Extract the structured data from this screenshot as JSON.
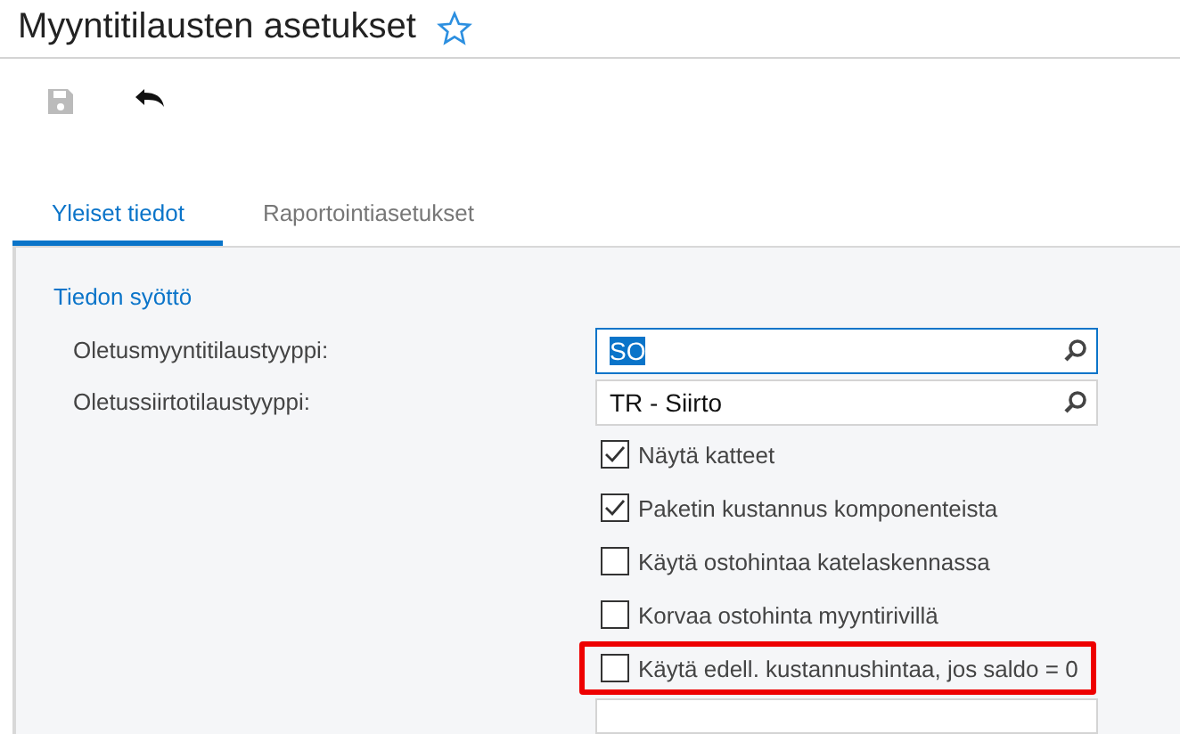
{
  "page": {
    "title": "Myyntitilausten asetukset",
    "favorite": false
  },
  "toolbar": [
    {
      "kind": "save",
      "disabled": true
    },
    {
      "kind": "undo",
      "disabled": false
    }
  ],
  "tabs": [
    {
      "label": "Yleiset tiedot",
      "selected": true
    },
    {
      "label": "Raportointiasetukset",
      "selected": false
    }
  ],
  "section": {
    "title": "Tiedon syöttö"
  },
  "fields": [
    {
      "label": "Oletusmyyntitilaustyyppi:",
      "value": "SO",
      "focused": true
    },
    {
      "label": "Oletussiirtotilaustyyppi:",
      "value": "TR - Siirto",
      "focused": false
    }
  ],
  "checkboxes": [
    {
      "label": "Näytä katteet",
      "checked": true,
      "highlighted": false
    },
    {
      "label": "Paketin kustannus komponenteista",
      "checked": true,
      "highlighted": false
    },
    {
      "label": "Käytä ostohintaa katelaskennassa",
      "checked": false,
      "highlighted": false
    },
    {
      "label": "Korvaa ostohinta myyntirivillä",
      "checked": false,
      "highlighted": false
    },
    {
      "label": "Käytä edell. kustannushintaa, jos saldo = 0",
      "checked": false,
      "highlighted": true
    }
  ]
}
